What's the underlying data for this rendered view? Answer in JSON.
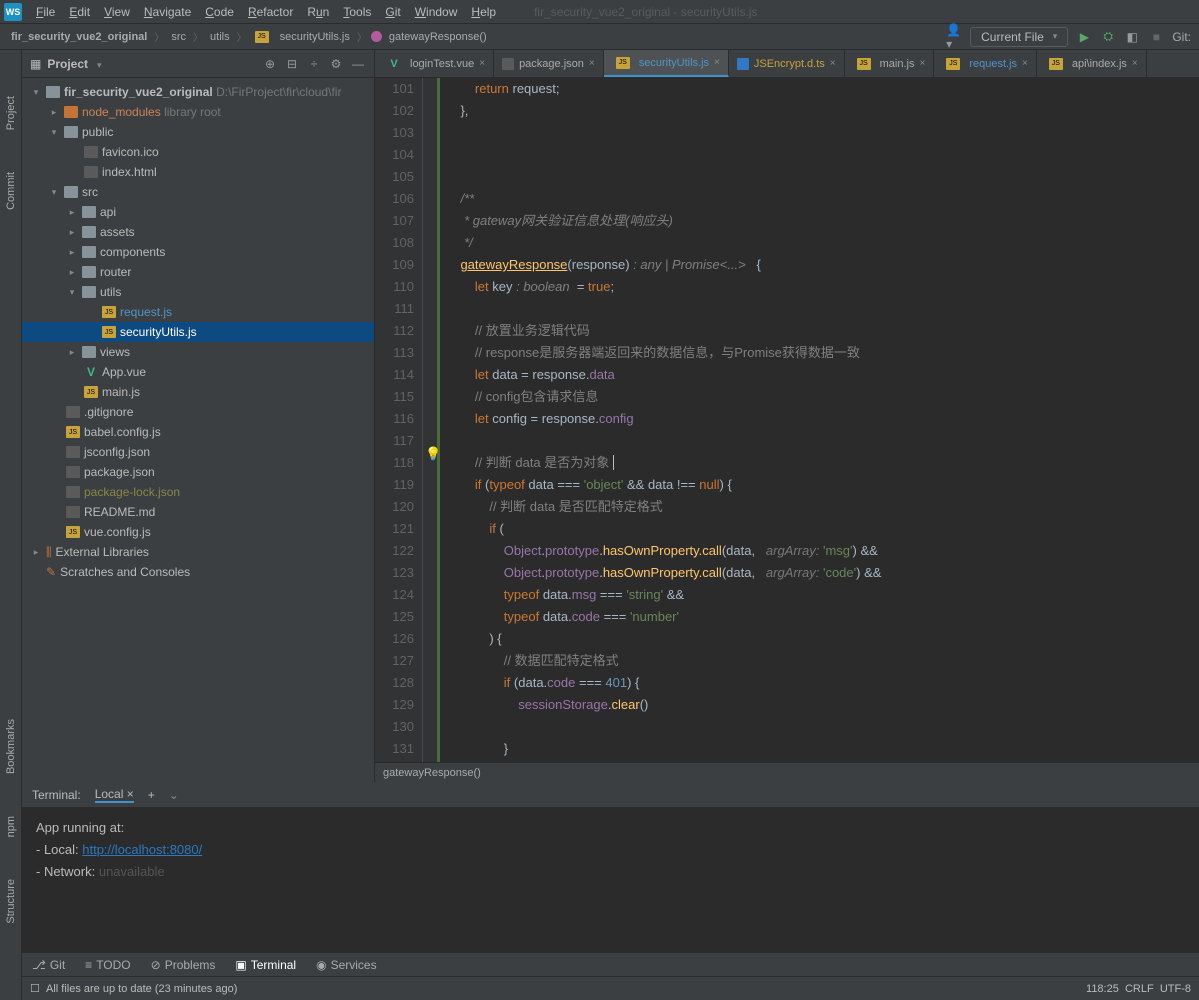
{
  "menu": {
    "file": "File",
    "edit": "Edit",
    "view": "View",
    "navigate": "Navigate",
    "code": "Code",
    "refactor": "Refactor",
    "run": "Run",
    "tools": "Tools",
    "git": "Git",
    "window": "Window",
    "help": "Help"
  },
  "windowTitle": "fir_security_vue2_original - securityUtils.js",
  "breadcrumb": {
    "project": "fir_security_vue2_original",
    "dir1": "src",
    "dir2": "utils",
    "file": "securityUtils.js",
    "fn": "gatewayResponse()"
  },
  "navRight": {
    "currentFile": "Current File",
    "git": "Git:"
  },
  "projectPanel": {
    "title": "Project"
  },
  "tree": {
    "root": "fir_security_vue2_original",
    "rootPath": "D:\\FirProject\\fir\\cloud\\fir",
    "node_modules": "node_modules",
    "libroot": "library root",
    "public": "public",
    "favicon": "favicon.ico",
    "indexhtml": "index.html",
    "src": "src",
    "api": "api",
    "assets": "assets",
    "components": "components",
    "router": "router",
    "utils": "utils",
    "request": "request.js",
    "security": "securityUtils.js",
    "views": "views",
    "appvue": "App.vue",
    "mainjs": "main.js",
    "gitignore": ".gitignore",
    "babel": "babel.config.js",
    "jsconfig": "jsconfig.json",
    "packagejson": "package.json",
    "packagelock": "package-lock.json",
    "readme": "README.md",
    "vueconfig": "vue.config.js",
    "extlib": "External Libraries",
    "scratches": "Scratches and Consoles"
  },
  "tabs": [
    {
      "label": "loginTest.vue"
    },
    {
      "label": "package.json"
    },
    {
      "label": "securityUtils.js",
      "active": true
    },
    {
      "label": "JSEncrypt.d.ts"
    },
    {
      "label": "main.js"
    },
    {
      "label": "request.js"
    },
    {
      "label": "api\\index.js"
    }
  ],
  "lineStart": 101,
  "lineEnd": 131,
  "code": {
    "l101": {
      "a": "return",
      "b": " request;"
    },
    "l102": "    },",
    "l106a": "/**",
    "l107a": " * gateway",
    "l107b": "网关验证信息处理(响应头)",
    "l108a": " */",
    "l109a": "gatewayResponse",
    "l109b": "(response)",
    "l109c": " : any | Promise<...> ",
    "l109d": "  {",
    "l110a": "let",
    "l110b": " key",
    "l110c": " : boolean ",
    "l110d": " = ",
    "l110e": "true",
    "l110f": ";",
    "l112c": "// 放置业务逻辑代码",
    "l113c": "// response是服务器端返回来的数据信息，与Promise获得数据一致",
    "l114a": "let",
    "l114b": " data = response.",
    "l114c": "data",
    "l115c": "// config包含请求信息",
    "l116a": "let",
    "l116b": " config = response.",
    "l116c": "config",
    "l118c": "// 判断 data 是否为对象",
    "l119a": "if ",
    "l119b": "(",
    "l119c": "typeof",
    "l119d": " data === ",
    "l119e": "'object'",
    "l119f": " && data !== ",
    "l119g": "null",
    "l119h": ") {",
    "l120c": "// 判断 data 是否匹配特定格式",
    "l121a": "if ",
    "l121b": "(",
    "l122a": "Object",
    "l122b": ".",
    "l122c": "prototype",
    "l122d": ".hasOwnProperty.",
    "l122e": "call",
    "l122f": "(data,",
    "l122g": " argArray:",
    "l122h": " 'msg'",
    "l122i": ") &&",
    "l123h": " 'code'",
    "l123i": ") &&",
    "l124a": "typeof",
    "l124b": " data.",
    "l124c": "msg",
    "l124d": " === ",
    "l124e": "'string'",
    "l124f": " &&",
    "l125a": "typeof",
    "l125b": " data.",
    "l125c": "code",
    "l125d": " === ",
    "l125e": "'number'",
    "l126": "        ) {",
    "l127c": "// 数据匹配特定格式",
    "l128a": "if ",
    "l128b": "(data.",
    "l128c": "code",
    "l128d": " === ",
    "l128e": "401",
    "l128f": ") {",
    "l129a": "sessionStorage",
    "l129b": ".",
    "l129c": "clear",
    "l129d": "()",
    "l131": "            }"
  },
  "breadcrumbBottom": "gatewayResponse()",
  "terminal": {
    "title": "Terminal:",
    "tab": "Local",
    "l1": "App running at:",
    "l2a": "- Local:   ",
    "l2b": "http://localhost:8080/",
    "l3a": "- Network: ",
    "l3b": "unavailable"
  },
  "toolWindows": {
    "git": "Git",
    "todo": "TODO",
    "problems": "Problems",
    "terminal": "Terminal",
    "services": "Services"
  },
  "leftBar": {
    "project": "Project",
    "commit": "Commit",
    "bookmarks": "Bookmarks",
    "structure": "Structure",
    "npm": "npm"
  },
  "status": {
    "msg": "All files are up to date (23 minutes ago)",
    "pos": "118:25",
    "le": "CRLF",
    "enc": "UTF-8"
  }
}
